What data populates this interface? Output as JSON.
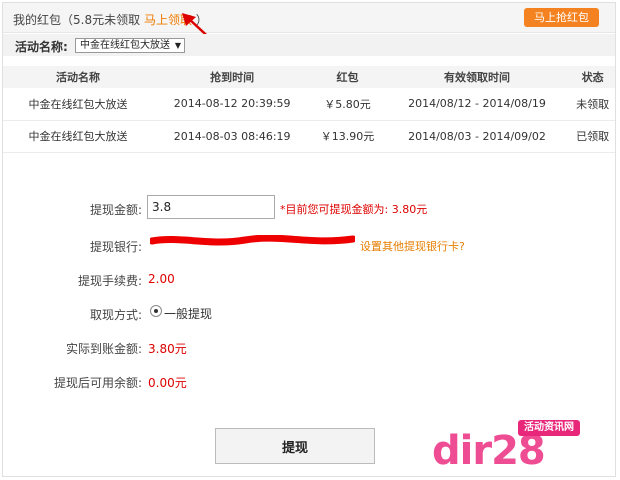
{
  "header": {
    "title_prefix": "我的红包（",
    "summary": "5.8元未领取",
    "claim_link": "马上领取",
    "title_suffix": "）",
    "grab_button": "马上抢红包"
  },
  "filter": {
    "label": "活动名称:",
    "selected": "中金在线红包大放送"
  },
  "table": {
    "columns": [
      "活动名称",
      "抢到时间",
      "红包",
      "有效领取时间",
      "状态"
    ],
    "rows": [
      [
        "中金在线红包大放送",
        "2014-08-12 20:39:59",
        "￥5.80元",
        "2014/08/12 - 2014/08/19",
        "未领取"
      ],
      [
        "中金在线红包大放送",
        "2014-08-03 08:46:19",
        "￥13.90元",
        "2014/08/03 - 2014/09/02",
        "已领取"
      ]
    ]
  },
  "form": {
    "amount_label": "提现金额:",
    "amount_value": "3.8",
    "amount_hint": "*目前您可提现金额为: 3.80元",
    "bank_label": "提现银行:",
    "bank_link": "设置其他提现银行卡?",
    "fee_label": "提现手续费:",
    "fee_value": "2.00",
    "method_label": "取现方式:",
    "method_value": "一般提现",
    "actual_label": "实际到账金额:",
    "actual_value": "3.80元",
    "balance_label": "提现后可用余额:",
    "balance_value": "0.00元",
    "submit": "提现"
  },
  "watermark": {
    "badge": "活动资讯网",
    "text": "dir28"
  },
  "colors": {
    "accent": "#f58220",
    "link": "#e67e00",
    "error": "#dd0000",
    "watermark": "#ee4d93"
  }
}
